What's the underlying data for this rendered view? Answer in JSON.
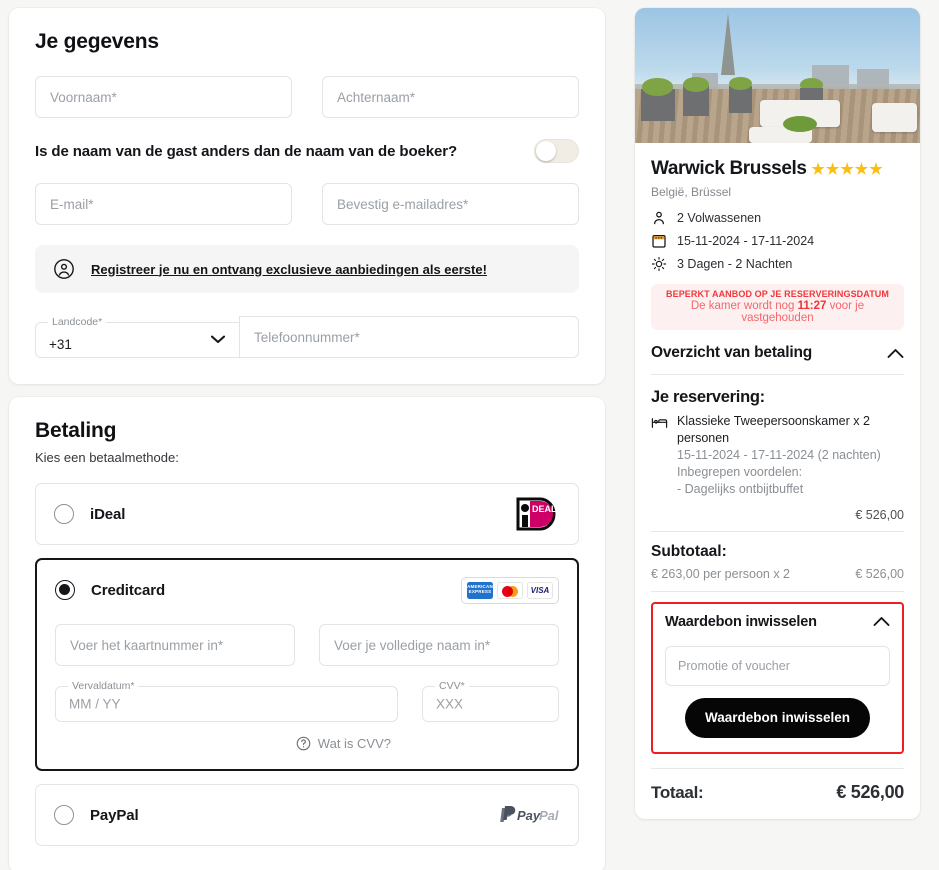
{
  "guest_section": {
    "title": "Je gegevens",
    "first_name_placeholder": "Voornaam*",
    "last_name_placeholder": "Achternaam*",
    "guest_different_question": "Is de naam van de gast anders dan de naam van de boeker?",
    "guest_different_toggle_state": "off",
    "email_placeholder": "E-mail*",
    "email_confirm_placeholder": "Bevestig e-mailadres*",
    "register_banner_text": "Registreer je nu en ontvang exclusieve aanbiedingen als eerste!",
    "country_code_label": "Landcode*",
    "country_code_value": "+31",
    "phone_placeholder": "Telefoonnummer*"
  },
  "payment_section": {
    "title": "Betaling",
    "subtitle": "Kies een betaalmethode:",
    "methods": [
      {
        "name": "iDeal",
        "selected": false,
        "logo": "ideal-logo"
      },
      {
        "name": "Creditcard",
        "selected": true,
        "logo": "card-brands-logo"
      },
      {
        "name": "PayPal",
        "selected": false,
        "logo": "paypal-logo"
      }
    ],
    "card_brands": [
      "AMERICAN EXPRESS",
      "mastercard",
      "VISA"
    ],
    "ideal_logo_text": "iDEAL",
    "paypal_logo_text": "PayPal",
    "card_number_placeholder": "Voer het kaartnummer in*",
    "card_holder_placeholder": "Voer je volledige naam in*",
    "expiry_label": "Vervaldatum*",
    "expiry_placeholder": "MM / YY",
    "cvv_label": "CVV*",
    "cvv_placeholder": "XXX",
    "cvv_help_text": "Wat is CVV?"
  },
  "sidebar": {
    "hotel_name": "Warwick Brussels",
    "star_rating": 5,
    "stars_glyphs": "★★★★★",
    "location": "België, Brüssel",
    "meta": [
      {
        "icon": "person-icon",
        "text": "2 Volwassenen"
      },
      {
        "icon": "calendar-icon",
        "text": "15-11-2024 - 17-11-2024"
      },
      {
        "icon": "sun-icon",
        "text": "3 Dagen - 2 Nachten"
      }
    ],
    "urgency": {
      "headline": "BEPERKT AANBOD OP JE RESERVERINGSDATUM",
      "text_before": "De kamer wordt nog ",
      "timer": "11:27",
      "text_after": " voor je vastgehouden"
    },
    "payment_overview_title": "Overzicht van betaling",
    "reservation_title": "Je reservering:",
    "room_name": "Klassieke Tweepersoonskamer x 2 personen",
    "room_dates": "15-11-2024 - 17-11-2024 (2 nachten)",
    "included_label": "Inbegrepen voordelen:",
    "included_item": "- Dagelijks ontbijtbuffet",
    "room_price": "€ 526,00",
    "subtotal_title": "Subtotaal:",
    "subtotal_per_person": "€ 263,00 per persoon x 2",
    "subtotal_amount": "€ 526,00",
    "voucher": {
      "title": "Waardebon inwisselen",
      "input_placeholder": "Promotie of voucher",
      "button_label": "Waardebon inwisselen",
      "highlight_color": "#ee1c24"
    },
    "total_label": "Totaal:",
    "total_amount": "€ 526,00"
  },
  "colors": {
    "page_background": "#f6f6f5",
    "accent_star": "#fbbf0f",
    "urgency_red": "#f0393c",
    "voucher_highlight": "#ee1c24",
    "button_dark": "#060606"
  }
}
